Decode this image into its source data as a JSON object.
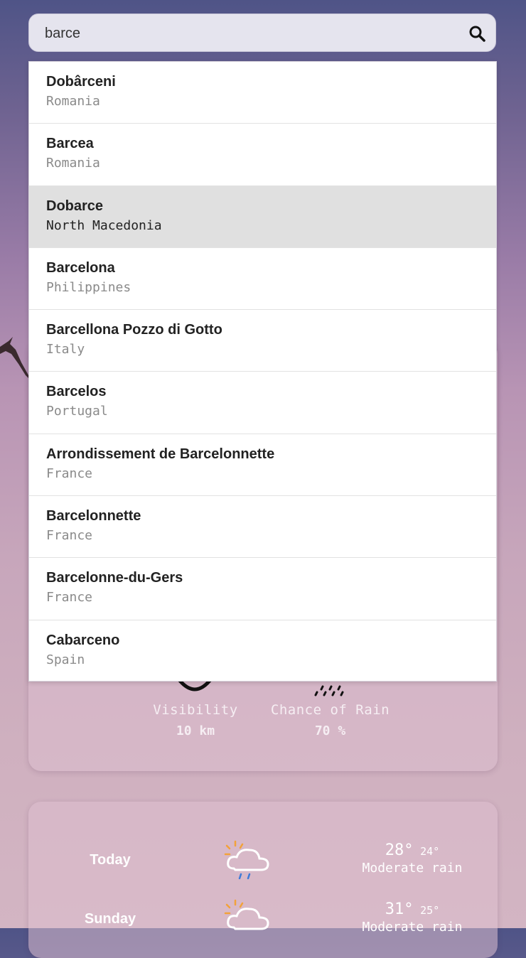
{
  "search": {
    "value": "barce",
    "placeholder": ""
  },
  "suggestions": [
    {
      "city": "Dobârceni",
      "country": "Romania"
    },
    {
      "city": "Barcea",
      "country": "Romania"
    },
    {
      "city": "Dobarce",
      "country": "North Macedonia",
      "highlighted": true
    },
    {
      "city": "Barcelona",
      "country": "Philippines"
    },
    {
      "city": "Barcellona Pozzo di Gotto",
      "country": "Italy"
    },
    {
      "city": "Barcelos",
      "country": "Portugal"
    },
    {
      "city": "Arrondissement de Barcelonnette",
      "country": "France"
    },
    {
      "city": "Barcelonnette",
      "country": "France"
    },
    {
      "city": "Barcelonne-du-Gers",
      "country": "France"
    },
    {
      "city": "Cabarceno",
      "country": "Spain"
    }
  ],
  "details": {
    "visibility": {
      "label": "Visibility",
      "value": "10 km"
    },
    "rain": {
      "label": "Chance of Rain",
      "value": "70 %"
    }
  },
  "forecast": [
    {
      "day": "Today",
      "high": "28°",
      "low": "24°",
      "condition": "Moderate rain",
      "icon": "sun-cloud-rain-icon"
    },
    {
      "day": "Sunday",
      "high": "31°",
      "low": "25°",
      "condition": "Moderate rain",
      "icon": "sun-cloud-rain-icon"
    }
  ],
  "colors": {
    "highlight": "#e0e0e0",
    "accent_sun": "#f2a23a",
    "rain_drop": "#3d7bd9"
  }
}
